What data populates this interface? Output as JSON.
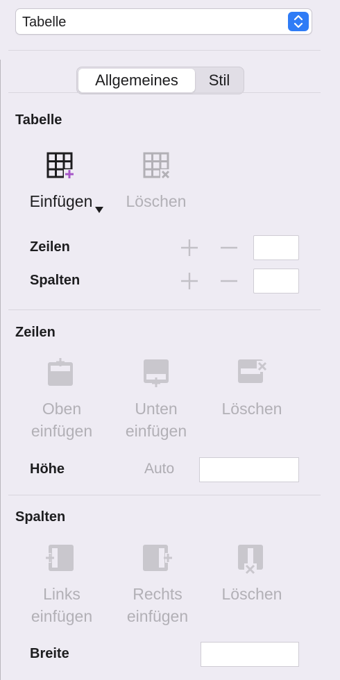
{
  "format_select": {
    "value": "Tabelle"
  },
  "tabs": [
    {
      "label": "Allgemeines",
      "active": true
    },
    {
      "label": "Stil",
      "active": false
    }
  ],
  "table_section": {
    "title": "Tabelle",
    "insert_label": "Einfügen",
    "delete_label": "Löschen",
    "rows_label": "Zeilen",
    "columns_label": "Spalten"
  },
  "rows_section": {
    "title": "Zeilen",
    "above_line1": "Oben",
    "above_line2": "einfügen",
    "below_line1": "Unten",
    "below_line2": "einfügen",
    "delete_label": "Löschen",
    "height_label": "Höhe",
    "height_auto": "Auto"
  },
  "columns_section": {
    "title": "Spalten",
    "left_line1": "Links",
    "left_line2": "einfügen",
    "right_line1": "Rechts",
    "right_line2": "einfügen",
    "delete_label": "Löschen",
    "width_label": "Breite"
  },
  "colors": {
    "accent": "#2f7cf6",
    "insert_plus": "#a657c8",
    "disabled": "#b2b0b6"
  }
}
